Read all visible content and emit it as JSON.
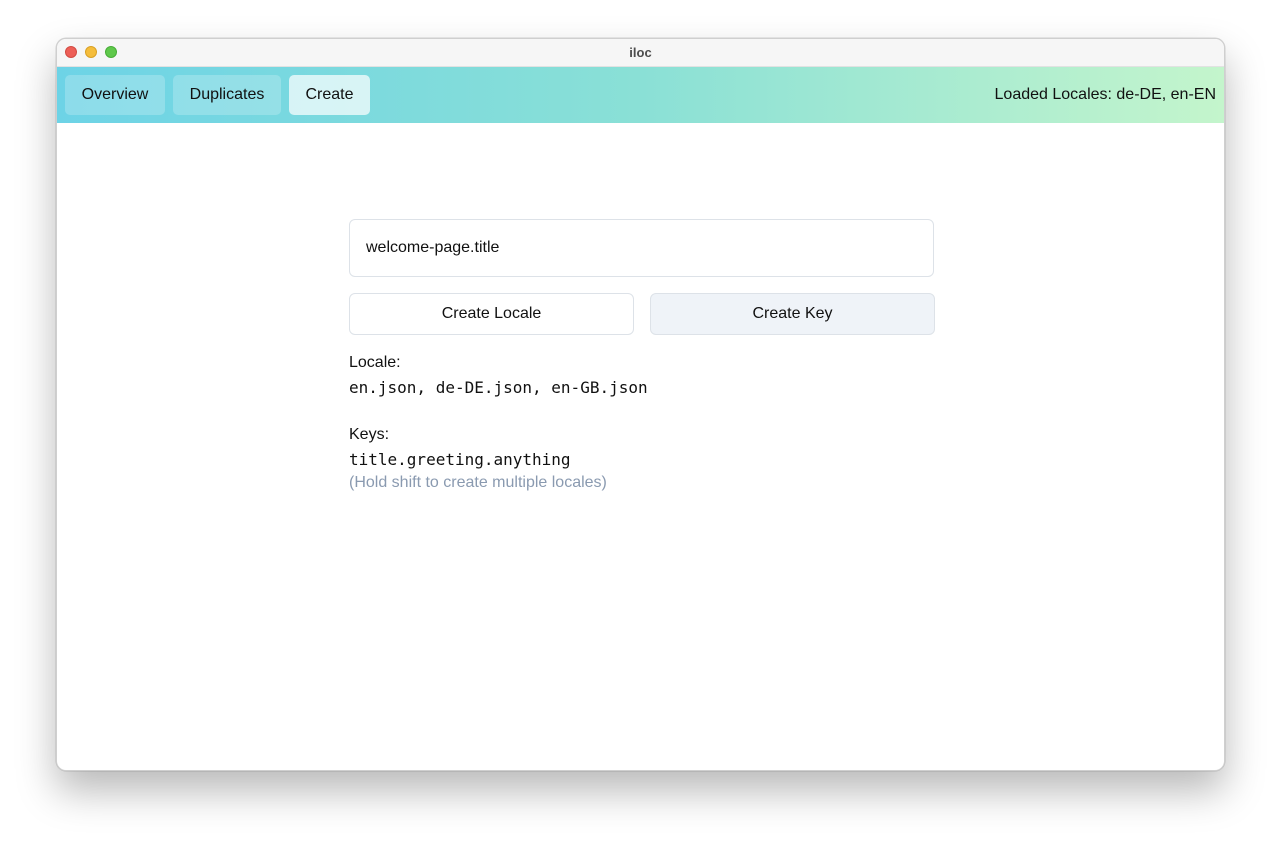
{
  "window": {
    "title": "iloc"
  },
  "nav": {
    "items": [
      {
        "label": "Overview"
      },
      {
        "label": "Duplicates"
      },
      {
        "label": "Create",
        "active": true
      }
    ],
    "loaded_locales": "Loaded Locales: de-DE, en-EN"
  },
  "form": {
    "key_input_value": "welcome-page.title",
    "create_locale_label": "Create Locale",
    "create_key_label": "Create Key"
  },
  "info": {
    "locale_label": "Locale:",
    "locale_values": "en.json, de-DE.json, en-GB.json",
    "keys_label": "Keys:",
    "keys_values": "title.greeting.anything",
    "hint": "(Hold shift to create multiple locales)"
  },
  "colors": {
    "nav_gradient_start": "#6dd3e6",
    "nav_gradient_end": "#c4f5cc",
    "hint_color": "#8a9ab0"
  }
}
